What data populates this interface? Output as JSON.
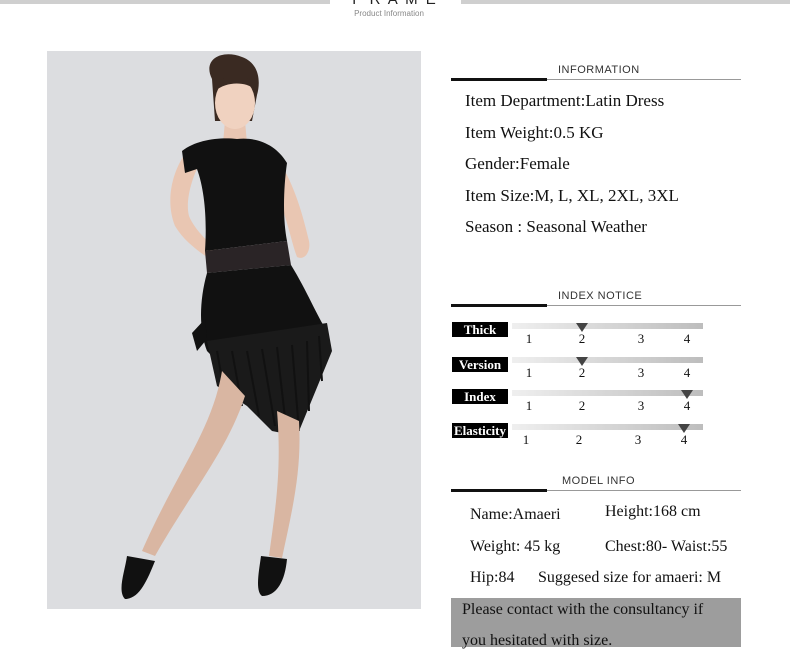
{
  "header": {
    "title": "F R A M E",
    "subtitle": "Product Information"
  },
  "information": {
    "heading": "INFORMATION",
    "lines": [
      "Item Department:Latin Dress",
      "Item Weight:0.5 KG",
      "Gender:Female",
      "Item Size:M, L, XL, 2XL, 3XL",
      "Season : Seasonal Weather"
    ]
  },
  "index_notice": {
    "heading": "INDEX NOTICE",
    "scale": [
      "1",
      "2",
      "3",
      "4"
    ],
    "rows": [
      {
        "label": "Thick",
        "level": 2
      },
      {
        "label": "Version",
        "level": 2
      },
      {
        "label": "Index",
        "level": 4
      },
      {
        "label": "Elasticity",
        "level": 4
      }
    ]
  },
  "model_info": {
    "heading": "MODEL INFO",
    "name": "Name:Amaeri",
    "height": "Height:168 cm",
    "weight": "Weight: 45  kg",
    "chest_waist": "Chest:80- Waist:55",
    "hip": "Hip:84",
    "suggested": "Suggesed size for amaeri: M"
  },
  "contact": {
    "line1": "Please contact with the consultancy if",
    "line2": "you hesitated with size."
  },
  "colors": {
    "photo_background": "#dcdde0",
    "dress": "#111111",
    "contact_background": "#9d9d9d"
  }
}
